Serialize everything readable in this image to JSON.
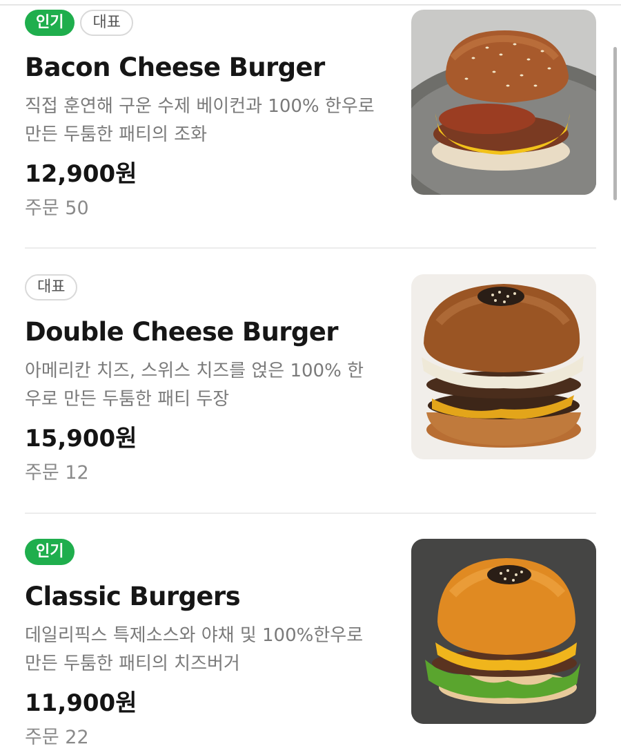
{
  "menu": {
    "items": [
      {
        "badges": [
          {
            "label": "인기",
            "type": "popular"
          },
          {
            "label": "대표",
            "type": "signature"
          }
        ],
        "name": "Bacon Cheese Burger",
        "description": "직접 훈연해 구운 수제 베이컨과 100% 한우로 만든 두툼한 패티의 조화",
        "price": "12,900원",
        "orders": "주문 50",
        "image_icon": "bacon-burger-photo"
      },
      {
        "badges": [
          {
            "label": "대표",
            "type": "signature"
          }
        ],
        "name": "Double Cheese Burger",
        "description": "아메리칸 치즈, 스위스 치즈를 얹은 100% 한우로 만든 두툼한 패티 두장",
        "price": "15,900원",
        "orders": "주문 12",
        "image_icon": "double-burger-photo"
      },
      {
        "badges": [
          {
            "label": "인기",
            "type": "popular"
          }
        ],
        "name": "Classic Burgers",
        "description": "데일리픽스 특제소스와 야채 및 100%한우로 만든 두툼한 패티의 치즈버거",
        "price": "11,900원",
        "orders": "주문 22",
        "image_icon": "classic-burger-photo"
      }
    ]
  },
  "colors": {
    "popular_badge": "#1fae4d",
    "divider": "#ececec",
    "muted_text": "#7a7a7a"
  }
}
